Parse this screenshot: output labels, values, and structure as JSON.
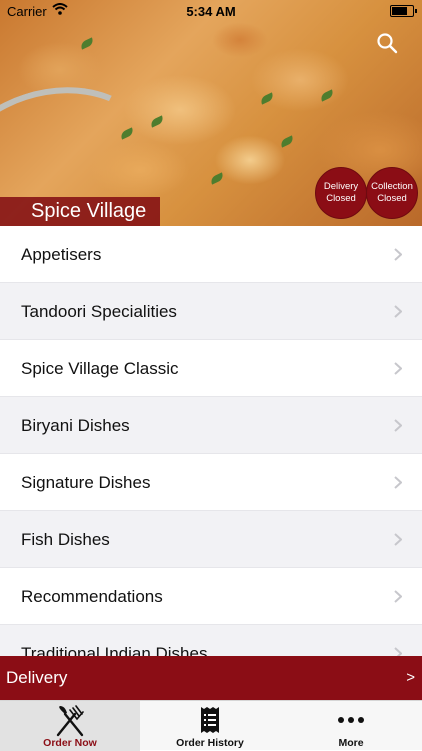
{
  "status_bar": {
    "carrier": "Carrier",
    "time": "5:34 AM"
  },
  "header": {
    "restaurant_name": "Spice Village",
    "search_icon": "search-icon",
    "delivery_badge": {
      "line1": "Delivery",
      "line2": "Closed"
    },
    "collection_badge": {
      "line1": "Collection",
      "line2": "Closed"
    }
  },
  "menu": {
    "categories": [
      {
        "label": "Appetisers"
      },
      {
        "label": "Tandoori Specialities"
      },
      {
        "label": "Spice Village Classic"
      },
      {
        "label": "Biryani Dishes"
      },
      {
        "label": "Signature Dishes"
      },
      {
        "label": "Fish Dishes"
      },
      {
        "label": "Recommendations"
      },
      {
        "label": "Traditional Indian Dishes"
      }
    ]
  },
  "order_mode": {
    "label": "Delivery",
    "arrow": ">"
  },
  "tabbar": {
    "tabs": [
      {
        "label": "Order Now",
        "icon": "fork-knife-icon"
      },
      {
        "label": "Order History",
        "icon": "receipt-icon"
      },
      {
        "label": "More",
        "icon": "more-dots-icon"
      }
    ]
  },
  "colors": {
    "brand": "#8b0d15",
    "row_alt": "#f2f2f5"
  }
}
